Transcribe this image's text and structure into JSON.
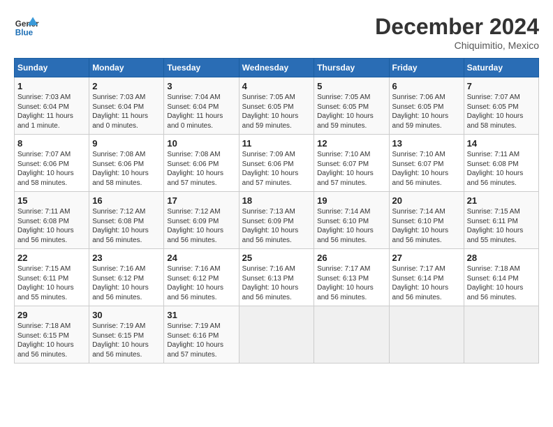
{
  "header": {
    "logo_line1": "General",
    "logo_line2": "Blue",
    "month": "December 2024",
    "location": "Chiquimitio, Mexico"
  },
  "weekdays": [
    "Sunday",
    "Monday",
    "Tuesday",
    "Wednesday",
    "Thursday",
    "Friday",
    "Saturday"
  ],
  "weeks": [
    [
      {
        "day": "1",
        "sunrise": "7:03 AM",
        "sunset": "6:04 PM",
        "daylight": "11 hours and 1 minute."
      },
      {
        "day": "2",
        "sunrise": "7:03 AM",
        "sunset": "6:04 PM",
        "daylight": "11 hours and 0 minutes."
      },
      {
        "day": "3",
        "sunrise": "7:04 AM",
        "sunset": "6:04 PM",
        "daylight": "11 hours and 0 minutes."
      },
      {
        "day": "4",
        "sunrise": "7:05 AM",
        "sunset": "6:05 PM",
        "daylight": "10 hours and 59 minutes."
      },
      {
        "day": "5",
        "sunrise": "7:05 AM",
        "sunset": "6:05 PM",
        "daylight": "10 hours and 59 minutes."
      },
      {
        "day": "6",
        "sunrise": "7:06 AM",
        "sunset": "6:05 PM",
        "daylight": "10 hours and 59 minutes."
      },
      {
        "day": "7",
        "sunrise": "7:07 AM",
        "sunset": "6:05 PM",
        "daylight": "10 hours and 58 minutes."
      }
    ],
    [
      {
        "day": "8",
        "sunrise": "7:07 AM",
        "sunset": "6:06 PM",
        "daylight": "10 hours and 58 minutes."
      },
      {
        "day": "9",
        "sunrise": "7:08 AM",
        "sunset": "6:06 PM",
        "daylight": "10 hours and 58 minutes."
      },
      {
        "day": "10",
        "sunrise": "7:08 AM",
        "sunset": "6:06 PM",
        "daylight": "10 hours and 57 minutes."
      },
      {
        "day": "11",
        "sunrise": "7:09 AM",
        "sunset": "6:06 PM",
        "daylight": "10 hours and 57 minutes."
      },
      {
        "day": "12",
        "sunrise": "7:10 AM",
        "sunset": "6:07 PM",
        "daylight": "10 hours and 57 minutes."
      },
      {
        "day": "13",
        "sunrise": "7:10 AM",
        "sunset": "6:07 PM",
        "daylight": "10 hours and 56 minutes."
      },
      {
        "day": "14",
        "sunrise": "7:11 AM",
        "sunset": "6:08 PM",
        "daylight": "10 hours and 56 minutes."
      }
    ],
    [
      {
        "day": "15",
        "sunrise": "7:11 AM",
        "sunset": "6:08 PM",
        "daylight": "10 hours and 56 minutes."
      },
      {
        "day": "16",
        "sunrise": "7:12 AM",
        "sunset": "6:08 PM",
        "daylight": "10 hours and 56 minutes."
      },
      {
        "day": "17",
        "sunrise": "7:12 AM",
        "sunset": "6:09 PM",
        "daylight": "10 hours and 56 minutes."
      },
      {
        "day": "18",
        "sunrise": "7:13 AM",
        "sunset": "6:09 PM",
        "daylight": "10 hours and 56 minutes."
      },
      {
        "day": "19",
        "sunrise": "7:14 AM",
        "sunset": "6:10 PM",
        "daylight": "10 hours and 56 minutes."
      },
      {
        "day": "20",
        "sunrise": "7:14 AM",
        "sunset": "6:10 PM",
        "daylight": "10 hours and 56 minutes."
      },
      {
        "day": "21",
        "sunrise": "7:15 AM",
        "sunset": "6:11 PM",
        "daylight": "10 hours and 55 minutes."
      }
    ],
    [
      {
        "day": "22",
        "sunrise": "7:15 AM",
        "sunset": "6:11 PM",
        "daylight": "10 hours and 55 minutes."
      },
      {
        "day": "23",
        "sunrise": "7:16 AM",
        "sunset": "6:12 PM",
        "daylight": "10 hours and 56 minutes."
      },
      {
        "day": "24",
        "sunrise": "7:16 AM",
        "sunset": "6:12 PM",
        "daylight": "10 hours and 56 minutes."
      },
      {
        "day": "25",
        "sunrise": "7:16 AM",
        "sunset": "6:13 PM",
        "daylight": "10 hours and 56 minutes."
      },
      {
        "day": "26",
        "sunrise": "7:17 AM",
        "sunset": "6:13 PM",
        "daylight": "10 hours and 56 minutes."
      },
      {
        "day": "27",
        "sunrise": "7:17 AM",
        "sunset": "6:14 PM",
        "daylight": "10 hours and 56 minutes."
      },
      {
        "day": "28",
        "sunrise": "7:18 AM",
        "sunset": "6:14 PM",
        "daylight": "10 hours and 56 minutes."
      }
    ],
    [
      {
        "day": "29",
        "sunrise": "7:18 AM",
        "sunset": "6:15 PM",
        "daylight": "10 hours and 56 minutes."
      },
      {
        "day": "30",
        "sunrise": "7:19 AM",
        "sunset": "6:15 PM",
        "daylight": "10 hours and 56 minutes."
      },
      {
        "day": "31",
        "sunrise": "7:19 AM",
        "sunset": "6:16 PM",
        "daylight": "10 hours and 57 minutes."
      },
      null,
      null,
      null,
      null
    ]
  ]
}
